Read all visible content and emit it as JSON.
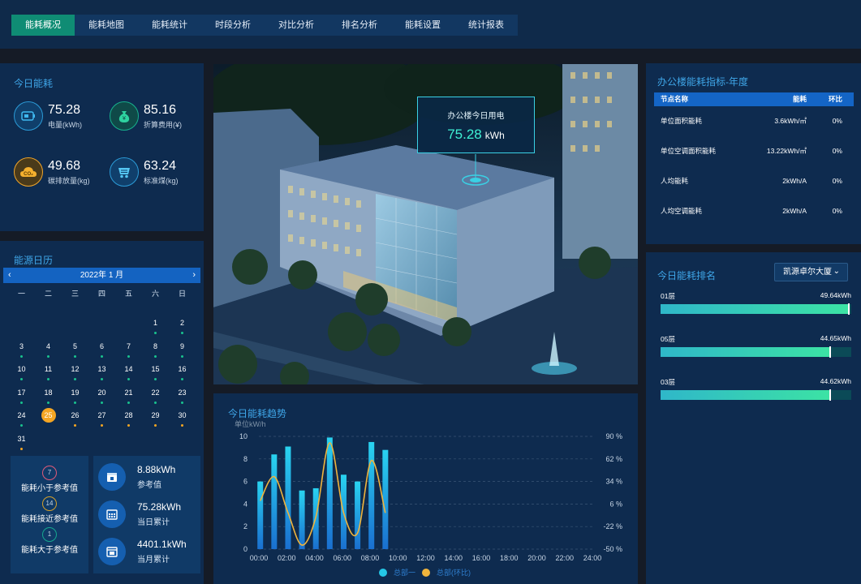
{
  "nav": {
    "items": [
      "能耗概况",
      "能耗地图",
      "能耗统计",
      "时段分析",
      "对比分析",
      "排名分析",
      "能耗设置",
      "统计报表"
    ],
    "active_index": 0
  },
  "today": {
    "title": "今日能耗",
    "kpis": [
      {
        "value": "75.28",
        "label": "电量(kWh)",
        "icon": "battery-icon"
      },
      {
        "value": "85.16",
        "label": "折算费用(¥)",
        "icon": "money-bag-icon"
      },
      {
        "value": "49.68",
        "label": "碳排放量(kg)",
        "icon": "co2-cloud-icon"
      },
      {
        "value": "63.24",
        "label": "标准煤(kg)",
        "icon": "coal-cart-icon"
      }
    ]
  },
  "calendar": {
    "title": "能源日历",
    "month_label": "2022年 1 月",
    "weekdays": [
      "一",
      "二",
      "三",
      "四",
      "五",
      "六",
      "日"
    ],
    "first_offset": 5,
    "days": 31,
    "today": 25,
    "green_days": [
      1,
      2,
      3,
      4,
      5,
      6,
      7,
      8,
      9,
      10,
      11,
      12,
      13,
      14,
      15,
      16,
      17,
      18,
      19,
      20,
      21,
      22,
      23,
      24
    ],
    "orange_days": [
      26,
      27,
      28,
      29,
      30,
      31
    ],
    "colors": {
      "green": "#19c28e",
      "orange": "#f5a623",
      "today": "#f5a623"
    }
  },
  "reference": {
    "items": [
      {
        "count": "7",
        "label": "能耗小于参考值",
        "color": "#e05a78"
      },
      {
        "count": "14",
        "label": "能耗接近参考值",
        "color": "#d6a02a"
      },
      {
        "count": "1",
        "label": "能耗大于参考值",
        "color": "#16a88f"
      }
    ]
  },
  "summary": {
    "items": [
      {
        "value": "8.88kWh",
        "label": "参考值",
        "icon": "calendar-day-icon"
      },
      {
        "value": "75.28kWh",
        "label": "当日累计",
        "icon": "calendar-grid-icon"
      },
      {
        "value": "4401.1kWh",
        "label": "当月累计",
        "icon": "calendar-month-icon"
      }
    ]
  },
  "callout": {
    "title": "办公楼今日用电",
    "value": "75.28",
    "unit": "kWh"
  },
  "index_table": {
    "title": "办公楼能耗指标-年度",
    "headers": [
      "节点名称",
      "能耗",
      "环比"
    ],
    "rows": [
      [
        "单位面积能耗",
        "3.6kWh/㎡",
        "0%"
      ],
      [
        "单位空调面积能耗",
        "13.22kWh/㎡",
        "0%"
      ],
      [
        "人均能耗",
        "2kWh/A",
        "0%"
      ],
      [
        "人均空调能耗",
        "2kWh/A",
        "0%"
      ]
    ]
  },
  "ranking": {
    "title": "今日能耗排名",
    "select_value": "凯源卓尔大厦",
    "max": 50,
    "items": [
      {
        "name": "01层",
        "value_label": "49.64kWh",
        "value": 49.64
      },
      {
        "name": "05层",
        "value_label": "44.65kWh",
        "value": 44.65
      },
      {
        "name": "03层",
        "value_label": "44.62kWh",
        "value": 44.62
      }
    ]
  },
  "trend": {
    "title": "今日能耗趋势"
  },
  "chart_data": {
    "type": "bar",
    "ylabel": "单位kW/h",
    "x_ticks": [
      "00:00",
      "02:00",
      "04:00",
      "06:00",
      "08:00",
      "10:00",
      "12:00",
      "14:00",
      "16:00",
      "18:00",
      "20:00",
      "22:00",
      "24:00"
    ],
    "ylim": [
      0,
      10
    ],
    "y_ticks": [
      0,
      2,
      4,
      6,
      8,
      10
    ],
    "y2_ticks": [
      "-50 %",
      "-22 %",
      "6 %",
      "34 %",
      "62 %",
      "90 %"
    ],
    "y2lim": [
      -50,
      90
    ],
    "grid": true,
    "legend_position": "bottom",
    "series": [
      {
        "name": "总部一",
        "type": "bar",
        "color": "#25c7e6",
        "x": [
          0,
          1,
          2,
          3,
          4,
          5,
          6,
          7,
          8,
          9
        ],
        "values": [
          6.0,
          8.4,
          9.1,
          5.2,
          5.4,
          9.9,
          6.6,
          6.0,
          9.5,
          8.8
        ]
      },
      {
        "name": "总部(环比)",
        "type": "line",
        "color": "#f0b43c",
        "x": [
          0,
          1,
          2,
          3,
          4,
          5,
          6,
          7,
          8,
          9
        ],
        "values": [
          10,
          40,
          -5,
          -45,
          -10,
          82,
          -5,
          -30,
          60,
          -5
        ]
      }
    ]
  }
}
